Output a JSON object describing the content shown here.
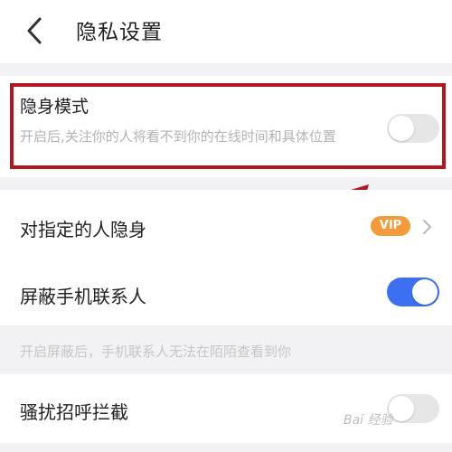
{
  "header": {
    "title": "隐私设置",
    "back_icon": "chevron-left-icon"
  },
  "invisible_mode": {
    "label": "隐身模式",
    "description": "开启后,关注你的人将看不到你的在线时间和具体位置",
    "enabled": false
  },
  "invisible_to_specific": {
    "label": "对指定的人隐身",
    "badge": "VIP"
  },
  "block_contacts": {
    "label": "屏蔽手机联系人",
    "enabled": true,
    "hint": "开启屏蔽后，手机联系人无法在陌陌查看到你"
  },
  "harassment_block": {
    "label": "骚扰招呼拦截",
    "enabled": false
  },
  "watermark": "Bai 经验",
  "colors": {
    "toggle_on": "#3c6ff2",
    "vip": "#f39a3c",
    "highlight": "#b3161c"
  }
}
